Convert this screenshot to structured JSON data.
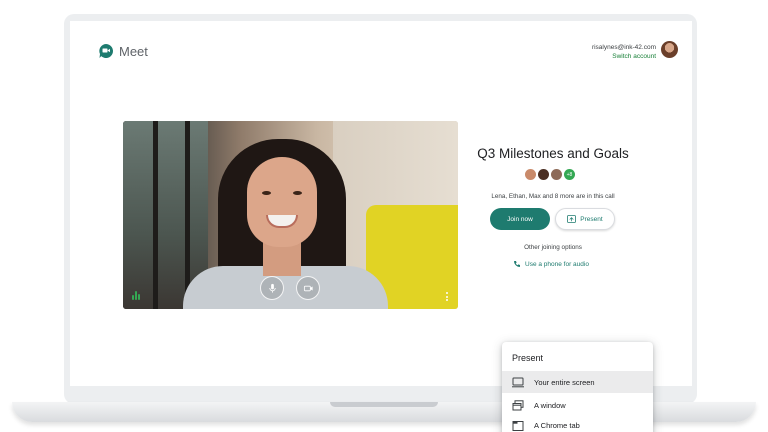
{
  "app": {
    "name": "Meet"
  },
  "account": {
    "email": "risalynes@ink-42.com",
    "switch_label": "Switch account"
  },
  "meeting": {
    "title": "Q3 Milestones and Goals",
    "participants_more": "+8",
    "in_call_text": "Lena, Ethan, Max and 8 more are in this call",
    "join_label": "Join now",
    "present_label": "Present",
    "other_options_label": "Other joining options",
    "phone_audio_label": "Use a phone for audio"
  },
  "present_menu": {
    "title": "Present",
    "items": [
      {
        "label": "Your entire screen",
        "icon": "monitor-icon"
      },
      {
        "label": "A window",
        "icon": "window-icon"
      },
      {
        "label": "A Chrome tab",
        "icon": "tab-icon"
      }
    ]
  },
  "colors": {
    "brand": "#1e7b6f",
    "accent_green": "#34a853",
    "text": "#202124"
  }
}
